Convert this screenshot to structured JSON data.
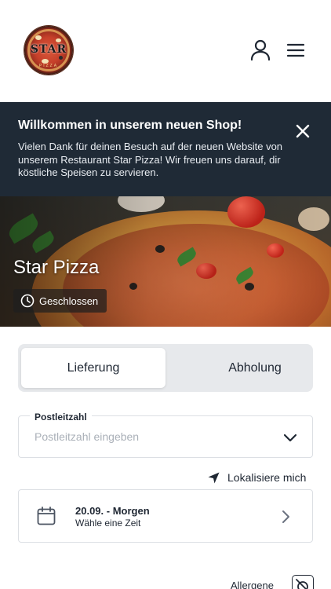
{
  "header": {
    "logo": {
      "text": "STAR",
      "subtext": "PIZZA"
    },
    "user_icon": "user-icon",
    "menu_icon": "hamburger-menu-icon"
  },
  "banner": {
    "title": "Willkommen in unserem neuen Shop!",
    "text": "Vielen Dank für deinen Besuch auf der neuen Website von unserem Restaurant Star Pizza! Wir freuen uns darauf, dir köstliche Speisen zu servieren.",
    "close_icon": "close-icon",
    "background": "#1f2a36"
  },
  "hero": {
    "title": "Star Pizza",
    "status": "Geschlossen",
    "status_icon": "clock-icon"
  },
  "order_mode": {
    "tabs": [
      {
        "label": "Lieferung",
        "active": true
      },
      {
        "label": "Abholung",
        "active": false
      }
    ]
  },
  "postcode": {
    "label": "Postleitzahl",
    "placeholder": "Postleitzahl eingeben",
    "value": ""
  },
  "locate": {
    "label": "Lokalisiere mich",
    "icon": "location-arrow-icon"
  },
  "time_select": {
    "date": "20.09. - Morgen",
    "hint": "Wähle eine Zeit",
    "icon": "calendar-icon"
  },
  "allergens": {
    "label": "Allergene",
    "icon": "allergen-filter-icon"
  }
}
